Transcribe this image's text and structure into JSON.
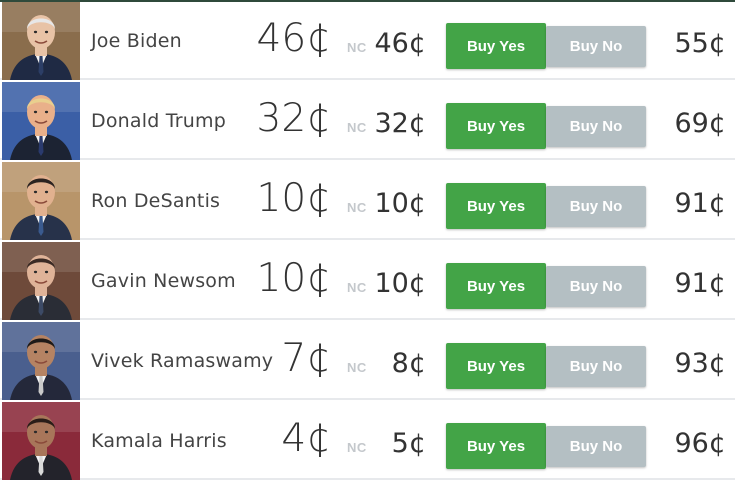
{
  "contracts": [
    {
      "name": "Joe Biden",
      "price": "46¢",
      "nc": "NC",
      "last": "46¢",
      "yes_label": "Buy Yes",
      "no_label": "Buy No",
      "no_price": "55¢",
      "bg": "#8a6d4c",
      "skin": "#e8c3a6",
      "hair": "#e7e7e7",
      "suit": "#1f2a44",
      "tie": "#2c3e66"
    },
    {
      "name": "Donald Trump",
      "price": "32¢",
      "nc": "NC",
      "last": "32¢",
      "yes_label": "Buy Yes",
      "no_label": "Buy No",
      "no_price": "69¢",
      "bg": "#3b5fa6",
      "skin": "#e9b08a",
      "hair": "#e9cf8e",
      "suit": "#1c2333",
      "tie": "#2a3a6e"
    },
    {
      "name": "Ron DeSantis",
      "price": "10¢",
      "nc": "NC",
      "last": "10¢",
      "yes_label": "Buy Yes",
      "no_label": "Buy No",
      "no_price": "91¢",
      "bg": "#b8956a",
      "skin": "#e1b18f",
      "hair": "#2b2320",
      "suit": "#27324a",
      "tie": "#3a5a8e"
    },
    {
      "name": "Gavin Newsom",
      "price": "10¢",
      "nc": "NC",
      "last": "10¢",
      "yes_label": "Buy Yes",
      "no_label": "Buy No",
      "no_price": "91¢",
      "bg": "#6e4a3a",
      "skin": "#dfb398",
      "hair": "#3a2a24",
      "suit": "#2a2d36",
      "tie": "#3c4a66"
    },
    {
      "name": "Vivek Ramaswamy",
      "price": "7¢",
      "nc": "NC",
      "last": "8¢",
      "yes_label": "Buy Yes",
      "no_label": "Buy No",
      "no_price": "93¢",
      "bg": "#4a5f8e",
      "skin": "#b58363",
      "hair": "#1e1a18",
      "suit": "#24283a",
      "tie": "#c9c9c9"
    },
    {
      "name": "Kamala Harris",
      "price": "4¢",
      "nc": "NC",
      "last": "5¢",
      "yes_label": "Buy Yes",
      "no_label": "Buy No",
      "no_price": "96¢",
      "bg": "#8a2a3a",
      "skin": "#a8765a",
      "hair": "#2a1d18",
      "suit": "#23232b",
      "tie": "#d9d9d9"
    }
  ]
}
